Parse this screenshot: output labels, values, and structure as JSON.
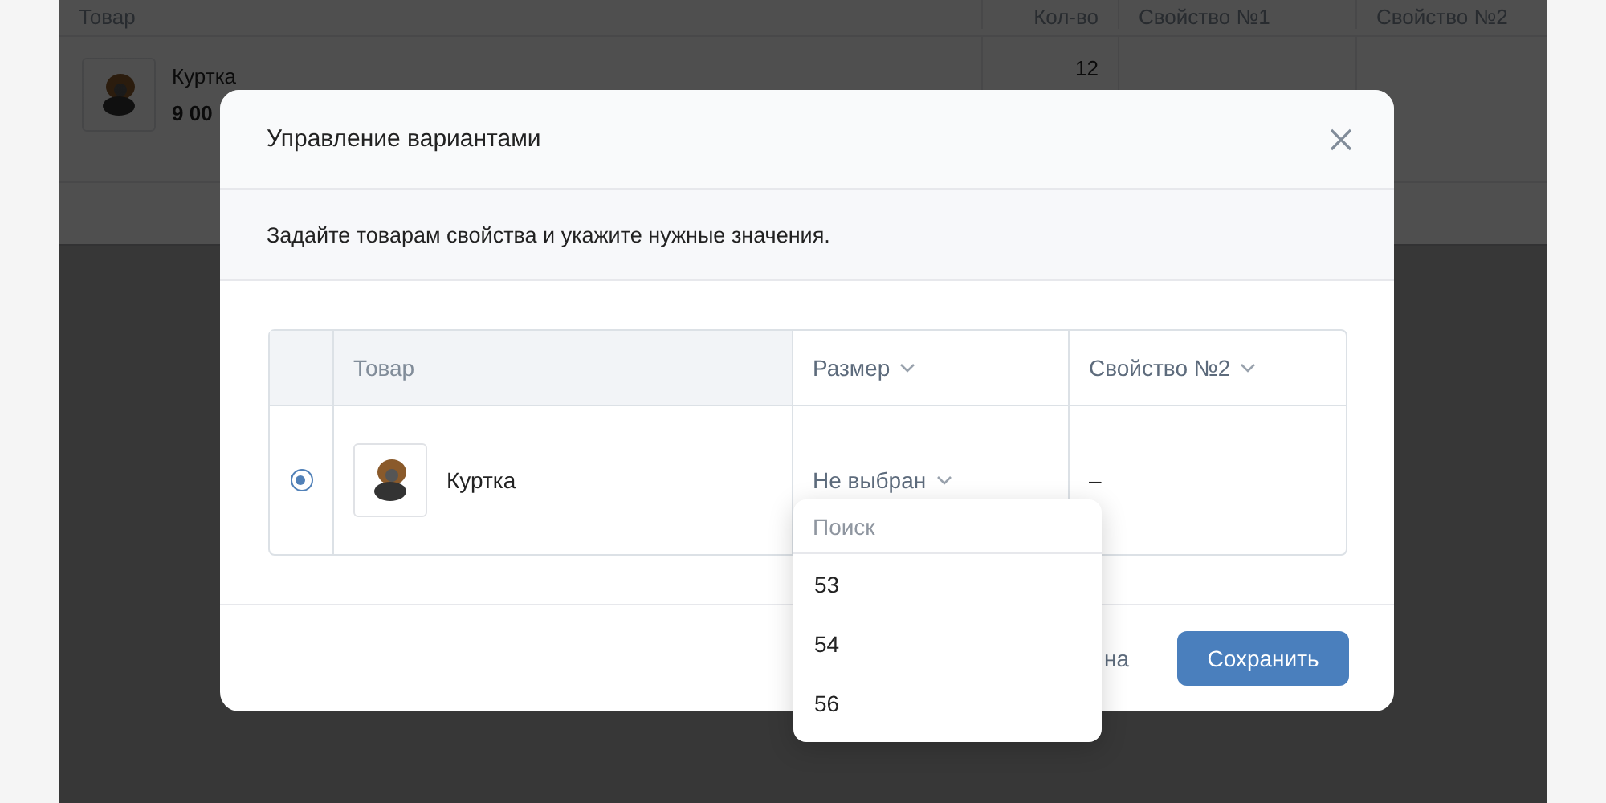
{
  "background_table": {
    "columns": [
      "Товар",
      "Кол-во",
      "Свойство №1",
      "Свойство №2"
    ],
    "rows": [
      {
        "name": "Куртка",
        "price": "9 00",
        "quantity": "12"
      }
    ]
  },
  "dialog": {
    "title": "Управление вариантами",
    "description": "Задайте товарам свойства и укажите нужные значения.",
    "table": {
      "columns": [
        {
          "label": "Товар",
          "kind": "plain"
        },
        {
          "label": "Размер",
          "kind": "dropdown"
        },
        {
          "label": "Свойство №2",
          "kind": "dropdown"
        }
      ],
      "rows": [
        {
          "selected": true,
          "name": "Куртка",
          "size": "Не выбран",
          "property_2": "–"
        }
      ]
    },
    "dropdown": {
      "placeholder": "Поиск",
      "options": [
        "53",
        "54",
        "56"
      ]
    },
    "buttons": [
      {
        "label": "на",
        "kind": "secondary"
      },
      {
        "label": "Сохранить",
        "kind": "primary"
      }
    ]
  }
}
